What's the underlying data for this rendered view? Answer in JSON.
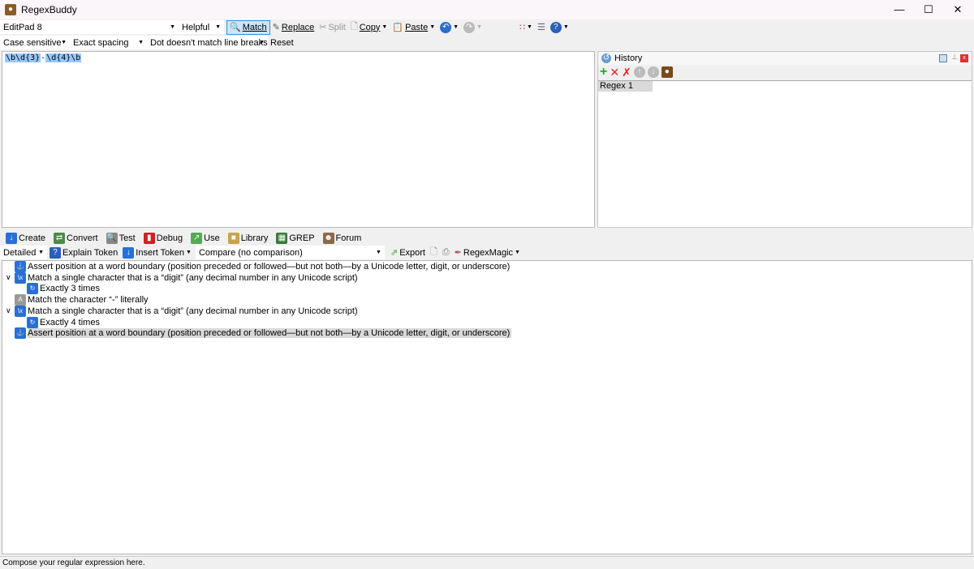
{
  "window": {
    "title": "RegexBuddy"
  },
  "toolbar1": {
    "application": "EditPad 8",
    "mode": "Helpful",
    "match": "Match",
    "replace": "Replace",
    "split": "Split",
    "copy": "Copy",
    "paste": "Paste"
  },
  "toolbar2": {
    "case": "Case sensitive",
    "spacing": "Exact spacing",
    "dot": "Dot doesn't match line breaks",
    "reset": "Reset"
  },
  "editor": {
    "regex_parts": [
      "\\b\\d{3}",
      "-",
      "\\d{4}\\b"
    ]
  },
  "history": {
    "title": "History",
    "items": [
      "Regex 1"
    ]
  },
  "tabs": [
    "Create",
    "Convert",
    "Test",
    "Debug",
    "Use",
    "Library",
    "GREP",
    "Forum"
  ],
  "create_toolbar": {
    "detail": "Detailed",
    "explain": "Explain Token",
    "insert": "Insert Token",
    "compare": "Compare (no comparison)",
    "export": "Export",
    "regexmagic": "RegexMagic"
  },
  "tree": [
    {
      "text": "Assert position at a word boundary (position preceded or followed—but not both—by a Unicode letter, digit, or underscore)",
      "icon": "anchor-icon",
      "level": 0
    },
    {
      "text": "Match a single character that is a “digit” (any decimal number in any Unicode script)",
      "icon": "class-icon",
      "level": 0,
      "expanded": true
    },
    {
      "text": "Exactly 3 times",
      "icon": "repeat-icon",
      "level": 1
    },
    {
      "text": "Match the character “-” literally",
      "icon": "literal-icon",
      "level": 0
    },
    {
      "text": "Match a single character that is a “digit” (any decimal number in any Unicode script)",
      "icon": "class-icon",
      "level": 0,
      "expanded": true
    },
    {
      "text": "Exactly 4 times",
      "icon": "repeat-icon",
      "level": 1
    },
    {
      "text": "Assert position at a word boundary (position preceded or followed—but not both—by a Unicode letter, digit, or underscore)",
      "icon": "anchor-icon",
      "level": 0,
      "selected": true
    }
  ],
  "status": "Compose your regular expression here."
}
